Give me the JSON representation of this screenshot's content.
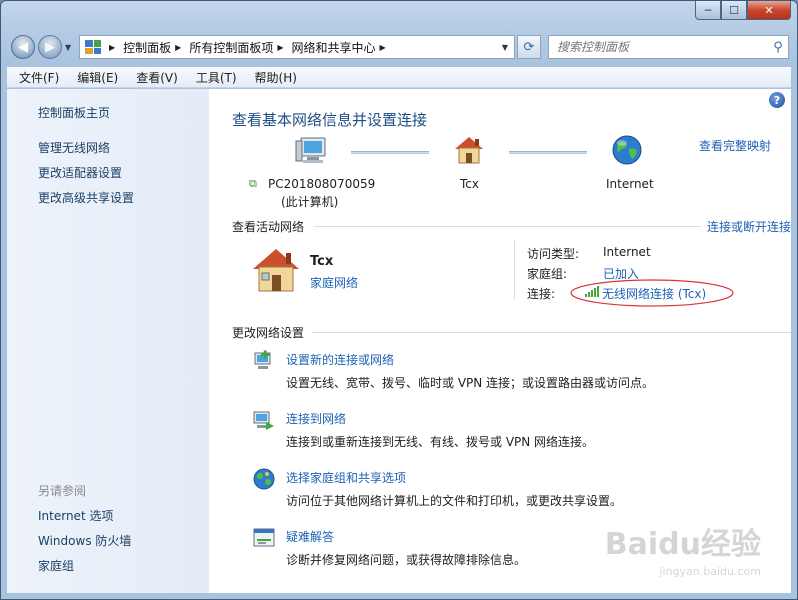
{
  "window": {
    "min": "─",
    "max": "☐",
    "close": "✕"
  },
  "nav": {
    "crumbs": [
      "控制面板",
      "所有控制面板项",
      "网络和共享中心"
    ],
    "search_placeholder": "搜索控制面板"
  },
  "menu": [
    "文件(F)",
    "编辑(E)",
    "查看(V)",
    "工具(T)",
    "帮助(H)"
  ],
  "sidebar": {
    "home": "控制面板主页",
    "links": [
      "管理无线网络",
      "更改适配器设置",
      "更改高级共享设置"
    ],
    "see_also_title": "另请参阅",
    "see_also": [
      "Internet 选项",
      "Windows 防火墙",
      "家庭组"
    ]
  },
  "main": {
    "title": "查看基本网络信息并设置连接",
    "full_map": "查看完整映射",
    "map": {
      "computer_name": "PC201808070059",
      "computer_sub": "(此计算机)",
      "network": "Tcx",
      "internet": "Internet"
    },
    "active_title": "查看活动网络",
    "connect_disconnect": "连接或断开连接",
    "network_name": "Tcx",
    "network_type": "家庭网络",
    "access_label": "访问类型:",
    "access_value": "Internet",
    "homegroup_label": "家庭组:",
    "homegroup_value": "已加入",
    "connection_label": "连接:",
    "connection_value": "无线网络连接 (Tcx)",
    "change_title": "更改网络设置",
    "tasks": [
      {
        "title": "设置新的连接或网络",
        "desc": "设置无线、宽带、拨号、临时或 VPN 连接；或设置路由器或访问点。"
      },
      {
        "title": "连接到网络",
        "desc": "连接到或重新连接到无线、有线、拨号或 VPN 网络连接。"
      },
      {
        "title": "选择家庭组和共享选项",
        "desc": "访问位于其他网络计算机上的文件和打印机，或更改共享设置。"
      },
      {
        "title": "疑难解答",
        "desc": "诊断并修复网络问题，或获得故障排除信息。"
      }
    ]
  },
  "watermark": {
    "brand": "Baidu经验",
    "url": "jingyan.baidu.com"
  },
  "colors": {
    "link": "#1d62b4",
    "title": "#1e4f87",
    "highlight_ellipse": "#d9343c"
  }
}
